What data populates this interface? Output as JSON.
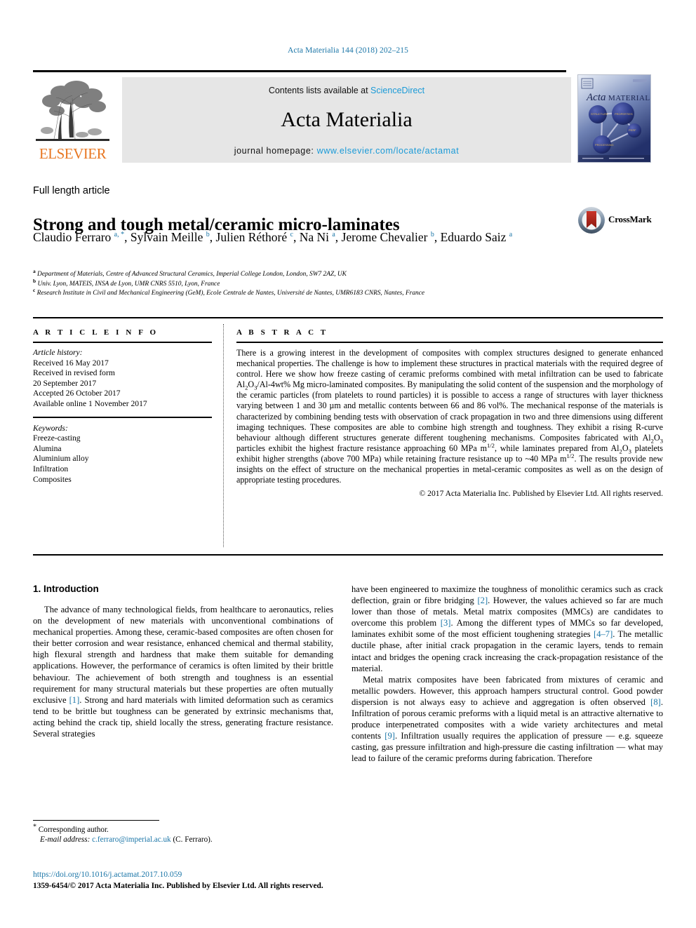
{
  "citation": "Acta Materialia 144 (2018) 202–215",
  "masthead": {
    "contents_prefix": "Contents lists available at ",
    "contents_link": "ScienceDirect",
    "journal_title": "Acta Materialia",
    "homepage_prefix": "journal homepage: ",
    "homepage_url": "www.elsevier.com/locate/actamat",
    "publisher_name": "ELSEVIER",
    "cover_title_italic": "Acta",
    "cover_title_rest": "MATERIALIA"
  },
  "article": {
    "type": "Full length article",
    "title": "Strong and tough metal/ceramic micro-laminates",
    "crossmark_label": "CrossMark",
    "authors": [
      {
        "name": "Claudio Ferraro",
        "marks": "a, *"
      },
      {
        "name": "Sylvain Meille",
        "marks": "b"
      },
      {
        "name": "Julien Réthoré",
        "marks": "c"
      },
      {
        "name": "Na Ni",
        "marks": "a"
      },
      {
        "name": "Jerome Chevalier",
        "marks": "b"
      },
      {
        "name": "Eduardo Saiz",
        "marks": "a"
      }
    ],
    "affiliations": [
      {
        "mark": "a",
        "text": "Department of Materials, Centre of Advanced Structural Ceramics, Imperial College London, London, SW7 2AZ, UK"
      },
      {
        "mark": "b",
        "text": "Univ. Lyon, MATEIS, INSA de Lyon, UMR CNRS 5510, Lyon, France"
      },
      {
        "mark": "c",
        "text": "Research Institute in Civil and Mechanical Engineering (GeM), Ecole Centrale de Nantes, Université de Nantes, UMR6183 CNRS, Nantes, France"
      }
    ]
  },
  "info": {
    "label": "A R T I C L E   I N F O",
    "history_title": "Article history:",
    "history": [
      "Received 16 May 2017",
      "Received in revised form",
      "20 September 2017",
      "Accepted 26 October 2017",
      "Available online 1 November 2017"
    ],
    "keywords_title": "Keywords:",
    "keywords": [
      "Freeze-casting",
      "Alumina",
      "Aluminium alloy",
      "Infiltration",
      "Composites"
    ]
  },
  "abstract": {
    "label": "A B S T R A C T",
    "copyright": "© 2017 Acta Materialia Inc. Published by Elsevier Ltd. All rights reserved."
  },
  "introduction": {
    "heading": "1. Introduction",
    "left_paragraph": "The advance of many technological fields, from healthcare to aeronautics, relies on the development of new materials with unconventional combinations of mechanical properties. Among these, ceramic-based composites are often chosen for their better corrosion and wear resistance, enhanced chemical and thermal stability, high flexural strength and hardness that make them suitable for demanding applications. However, the performance of ceramics is often limited by their brittle behaviour. The achievement of both strength and toughness is an essential requirement for many structural materials but these properties are often mutually exclusive [1]. Strong and hard materials with limited deformation such as ceramics tend to be brittle but toughness can be generated by extrinsic mechanisms that, acting behind the crack tip, shield locally the stress, generating fracture resistance. Several strategies"
  },
  "footer": {
    "corresponding_marker": "*",
    "corresponding_label": "Corresponding author.",
    "email_label": "E-mail address:",
    "email": "c.ferraro@imperial.ac.uk",
    "email_owner": "(C. Ferraro).",
    "doi": "https://doi.org/10.1016/j.actamat.2017.10.059",
    "issn_line": "1359-6454/© 2017 Acta Materialia Inc. Published by Elsevier Ltd. All rights reserved."
  },
  "colors": {
    "link_blue": "#1a75a7",
    "sciencedirect_blue": "#1a9ad7",
    "elsevier_orange": "#e87722",
    "band_gray": "#e6e6e6"
  }
}
